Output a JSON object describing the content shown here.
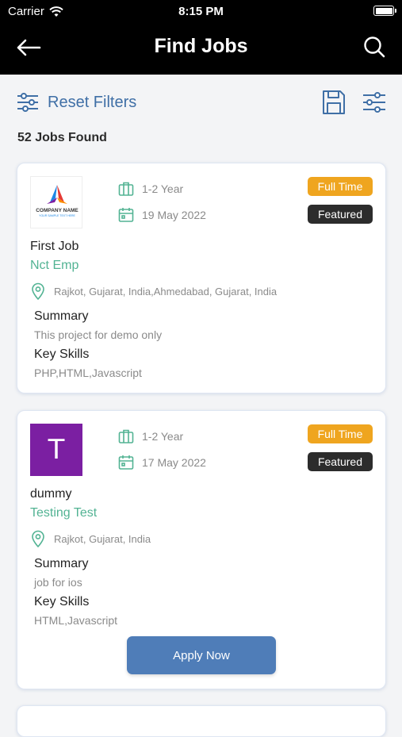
{
  "status_bar": {
    "carrier": "Carrier",
    "time": "8:15 PM"
  },
  "header": {
    "title": "Find Jobs"
  },
  "filters": {
    "reset_label": "Reset Filters"
  },
  "results": {
    "count_text": "52 Jobs Found"
  },
  "jobs": [
    {
      "logo_company_text": "COMPANY NAME",
      "logo_tagline": "YOUR SAMPLE TEXT HERE",
      "experience": "1-2 Year",
      "date": "19 May 2022",
      "type_badge": "Full Time",
      "featured_badge": "Featured",
      "title": "First Job",
      "company": "Nct Emp",
      "location": "Rajkot, Gujarat, India,Ahmedabad, Gujarat, India",
      "summary_label": "Summary",
      "summary": "This project for demo only",
      "skills_label": "Key Skills",
      "skills": "PHP,HTML,Javascript"
    },
    {
      "logo_letter": "T",
      "experience": "1-2 Year",
      "date": "17 May 2022",
      "type_badge": "Full Time",
      "featured_badge": "Featured",
      "title": "dummy",
      "company": "Testing Test",
      "location": "Rajkot, Gujarat, India",
      "summary_label": "Summary",
      "summary": "job for ios",
      "skills_label": "Key Skills",
      "skills": "HTML,Javascript",
      "apply_label": "Apply Now"
    }
  ],
  "colors": {
    "header_bg": "#000000",
    "accent_blue": "#3f6fa6",
    "company_green": "#52b393",
    "badge_full_time": "#efa51f",
    "badge_featured": "#2c2c2c",
    "apply_button": "#4f7db8",
    "letter_logo_bg": "#7b1fa2"
  },
  "icons": [
    "wifi-icon",
    "battery-icon",
    "back-arrow-icon",
    "search-icon",
    "sliders-icon",
    "save-icon",
    "filter-icon",
    "briefcase-icon",
    "calendar-icon",
    "location-pin-icon"
  ]
}
